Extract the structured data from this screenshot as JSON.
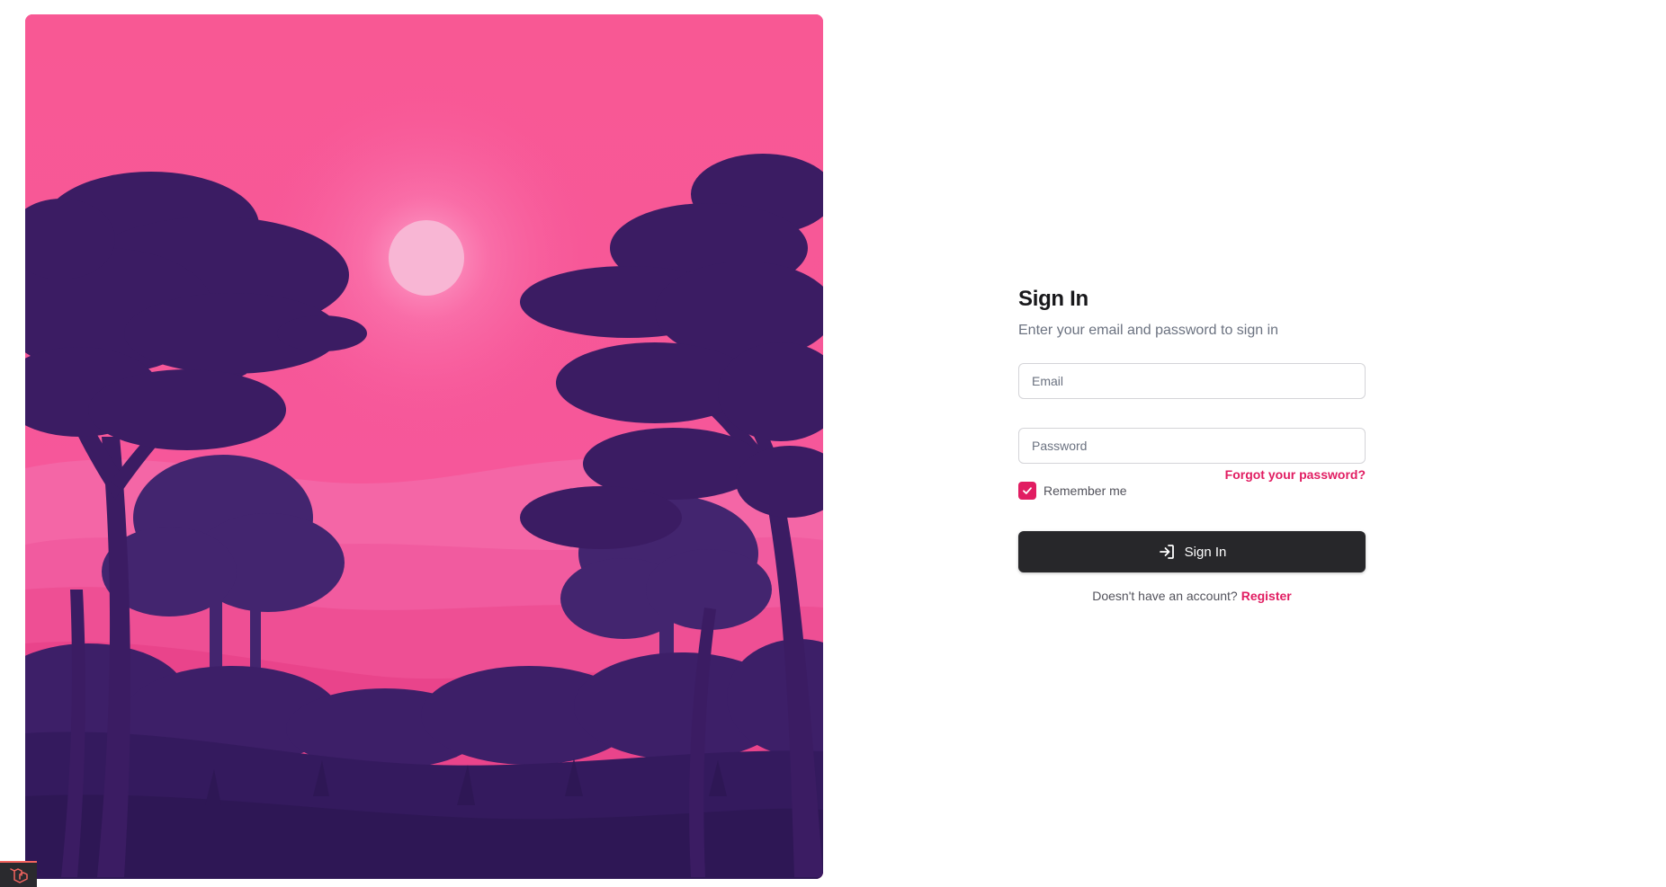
{
  "colors": {
    "accent": "#e11d62",
    "button_bg": "#27272a",
    "hero_sky": "#f6579a",
    "hero_silhouette": "#3b1c63"
  },
  "hero": {
    "alt_description": "",
    "icon": "forest-sunset-illustration"
  },
  "form": {
    "title": "Sign In",
    "subtitle": "Enter your email and password to sign in",
    "email": {
      "placeholder": "Email",
      "value": ""
    },
    "password": {
      "placeholder": "Password",
      "value": ""
    },
    "forgot_label": "Forgot your password?",
    "remember_label": "Remember me",
    "remember_checked": true,
    "submit_label": "Sign In",
    "submit_icon": "login-arrow-icon",
    "register_prompt": "Doesn't have an account?",
    "register_label": "Register"
  },
  "debug_bar": {
    "icon": "laravel-logo-icon"
  }
}
